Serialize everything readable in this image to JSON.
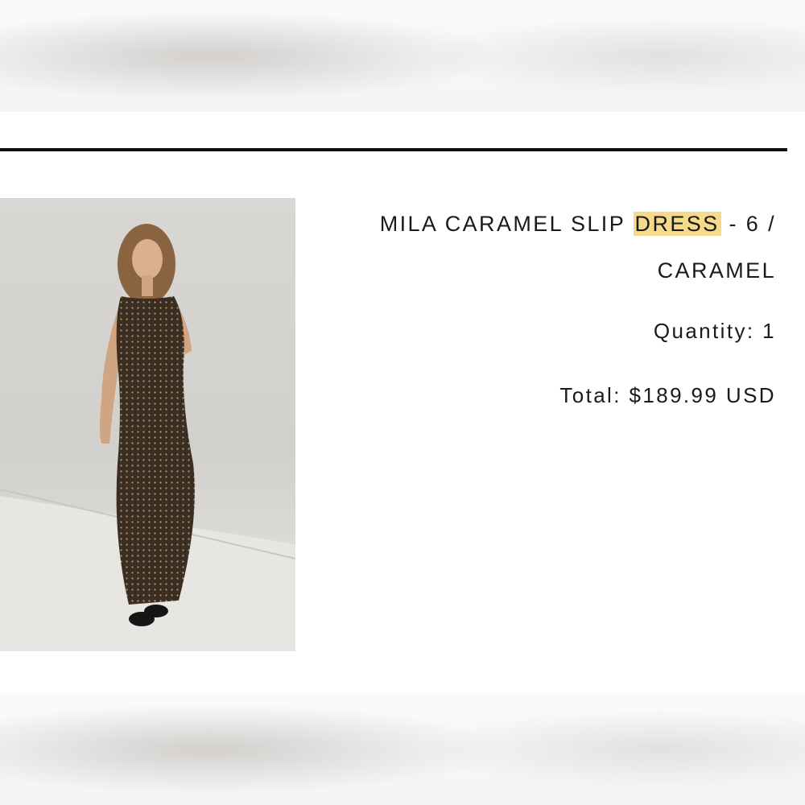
{
  "product": {
    "name_before": "MILA CARAMEL SLIP",
    "name_highlight": "DRESS",
    "name_after": "- 6 /",
    "variant": "CARAMEL",
    "highlight_color": "#f7d98a"
  },
  "quantity": {
    "label": "Quantity:",
    "value": "1"
  },
  "total": {
    "label": "Total:",
    "value": "$189.99 USD"
  },
  "image": {
    "description_icon": "product-photo"
  }
}
